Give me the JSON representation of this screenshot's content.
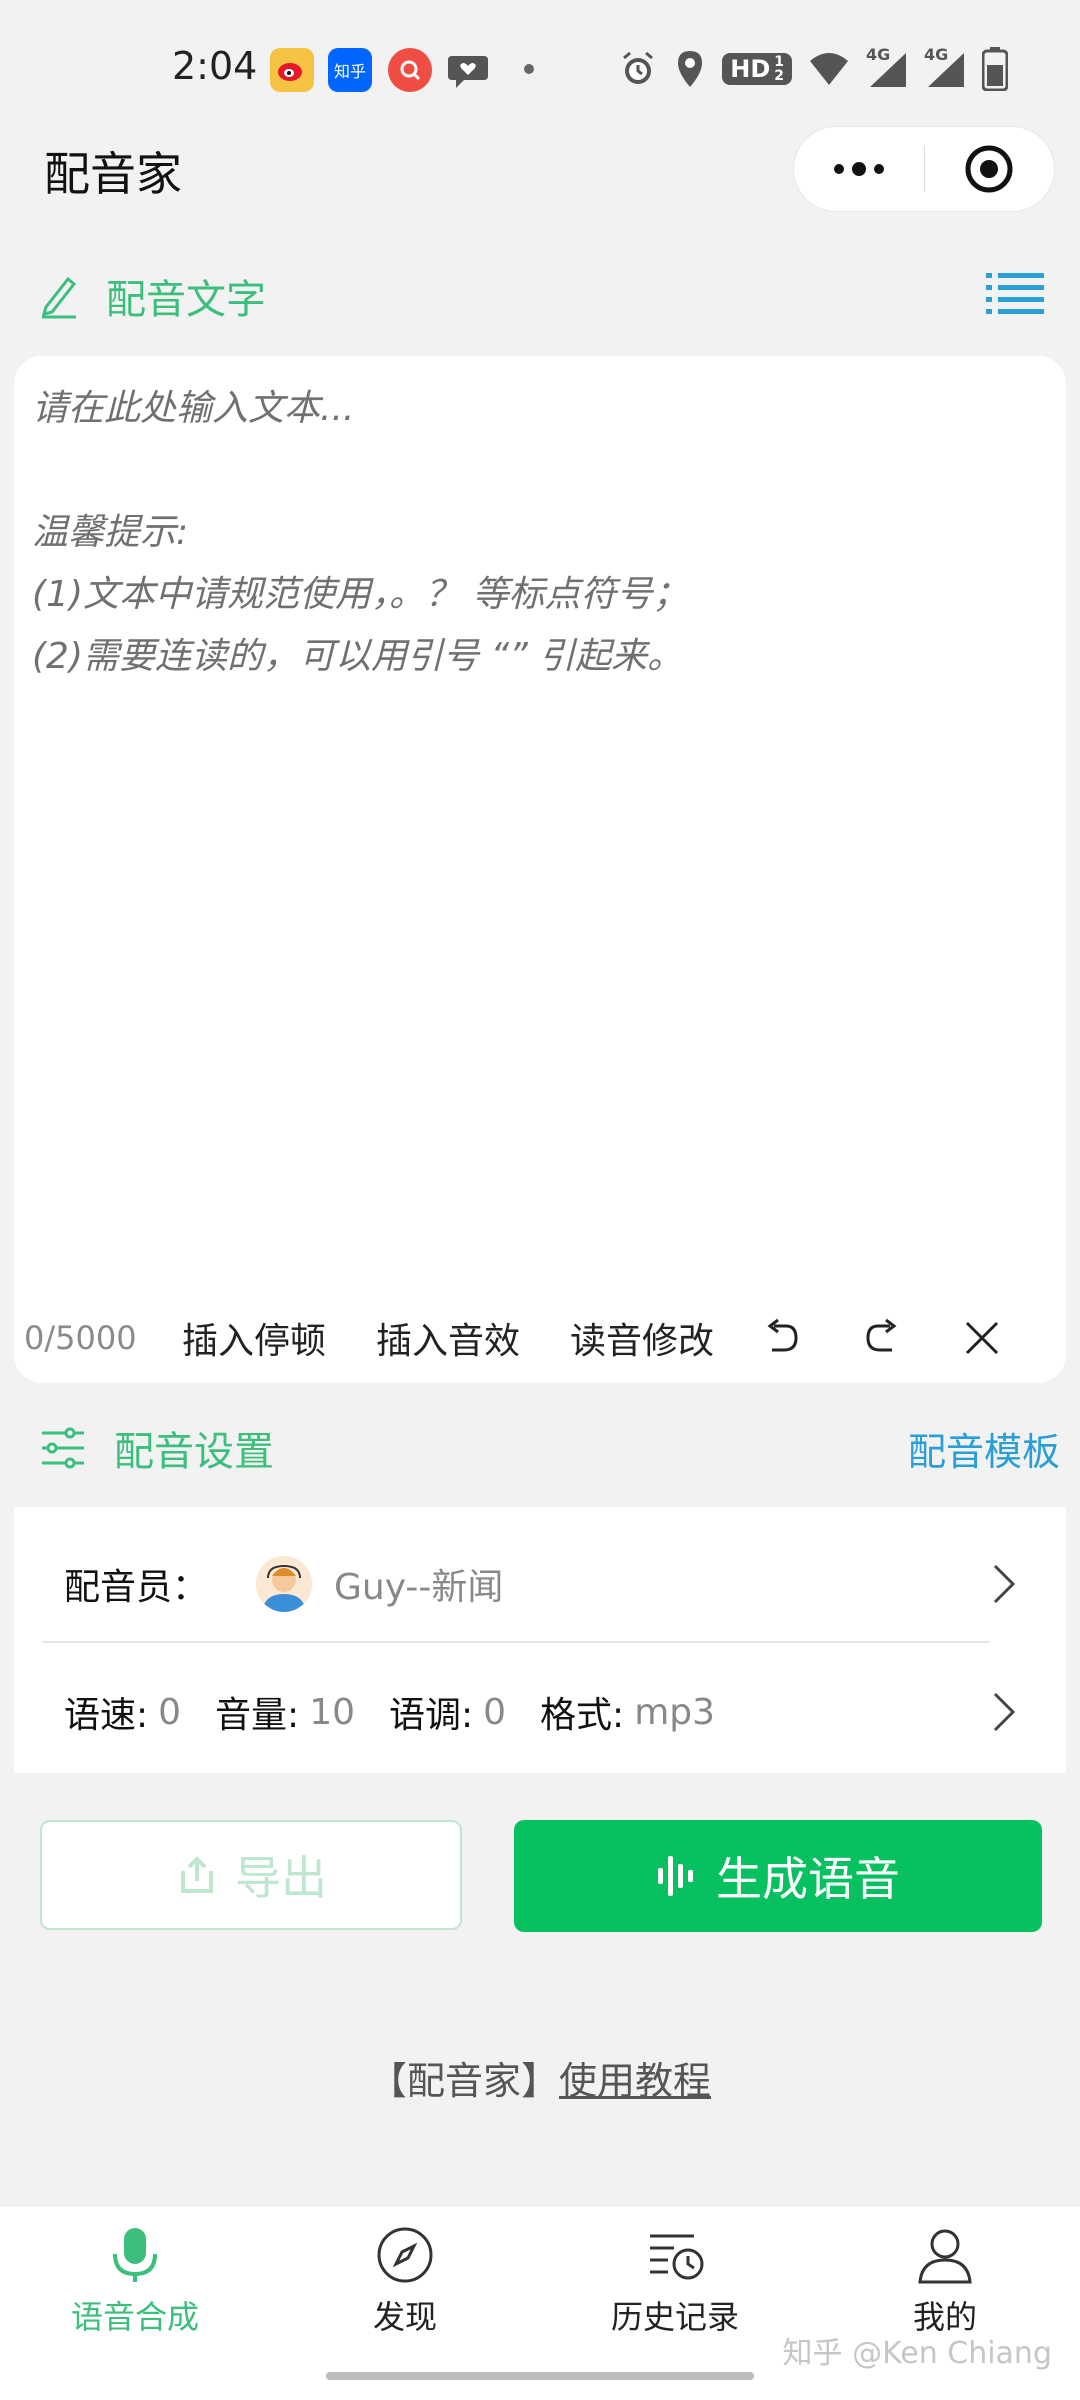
{
  "status_bar": {
    "time": "2:04",
    "apps": [
      "weibo-icon",
      "zhihu-icon",
      "search-app-icon",
      "chat-icon"
    ],
    "zhihu_label": "知乎",
    "hd_label": "HD",
    "network_1": "4G",
    "network_2": "4G"
  },
  "header": {
    "title": "配音家"
  },
  "text_section": {
    "label": "配音文字",
    "placeholder": "请在此处输入文本...\n\n温馨提示:\n(1)文本中请规范使用，。？ 等标点符号；\n(2)需要连读的，可以用引号 “” 引起来。",
    "counter": "0/5000",
    "tools": [
      "插入停顿",
      "插入音效",
      "读音修改"
    ]
  },
  "settings_section": {
    "label": "配音设置",
    "template_link": "配音模板",
    "voice_label": "配音员：",
    "voice_value": "Guy--新闻",
    "speed_label": "语速:",
    "speed_value": "0",
    "volume_label": "音量:",
    "volume_value": "10",
    "pitch_label": "语调:",
    "pitch_value": "0",
    "format_label": "格式:",
    "format_value": "mp3"
  },
  "actions": {
    "export_label": "导出",
    "generate_label": "生成语音"
  },
  "tutorial": {
    "prefix": "【配音家】",
    "link": "使用教程"
  },
  "tabbar": {
    "tabs": [
      {
        "label": "语音合成",
        "icon": "microphone-icon",
        "active": true
      },
      {
        "label": "发现",
        "icon": "compass-icon",
        "active": false
      },
      {
        "label": "历史记录",
        "icon": "history-icon",
        "active": false
      },
      {
        "label": "我的",
        "icon": "person-icon",
        "active": false
      }
    ]
  },
  "watermark": "知乎 @Ken Chiang",
  "colors": {
    "accent_green": "#3cbe7d",
    "primary_button": "#07c160",
    "link_blue": "#2a9fd6"
  }
}
